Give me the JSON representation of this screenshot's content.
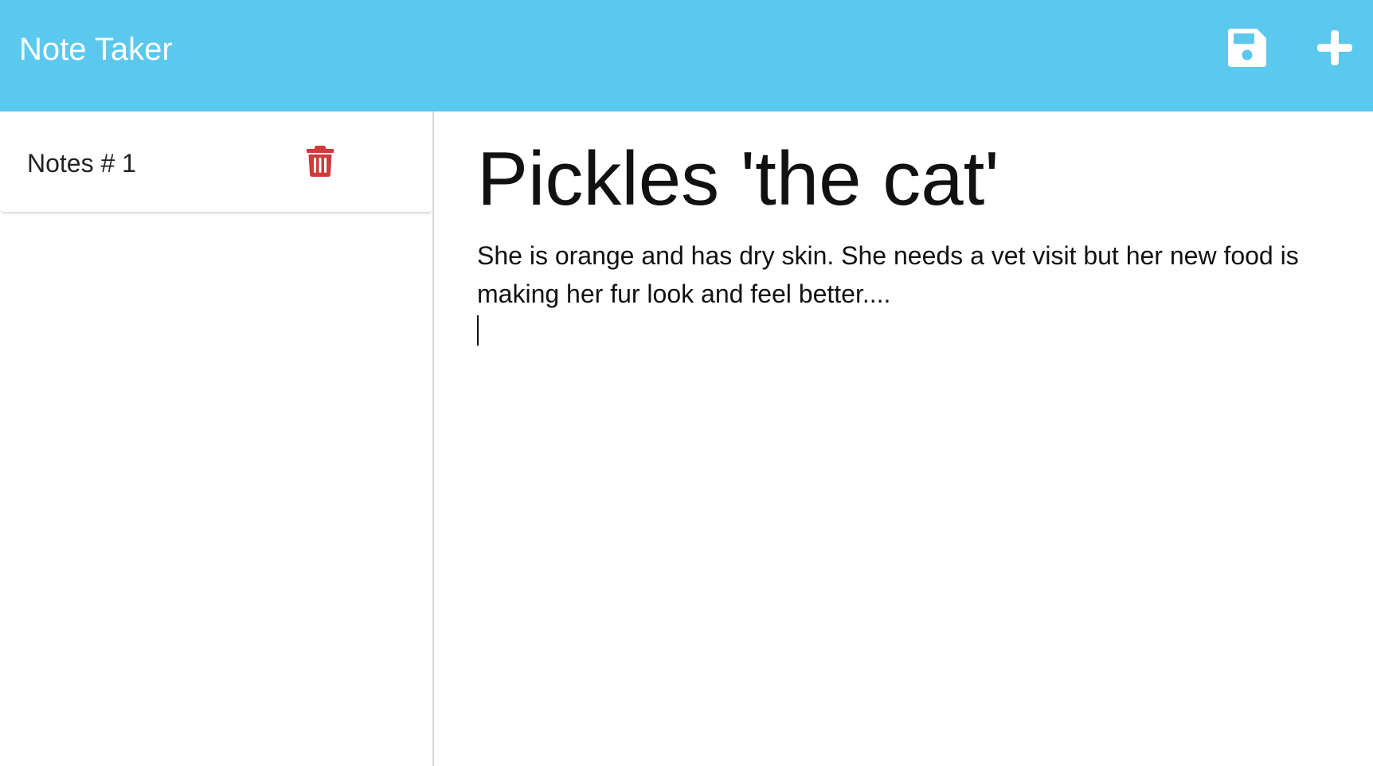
{
  "navbar": {
    "brand": "Note Taker",
    "save_icon": "floppy-disk-icon",
    "new_icon": "plus-icon",
    "color": "#5bc8ee"
  },
  "sidebar": {
    "notes": [
      {
        "title": "Notes # 1",
        "delete_icon": "trash-icon"
      }
    ],
    "delete_color": "#d13a3a"
  },
  "editor": {
    "title": "Pickles 'the cat'",
    "body": "She is orange and has dry skin. She needs a vet visit but her new food is making her fur look and feel better...."
  }
}
